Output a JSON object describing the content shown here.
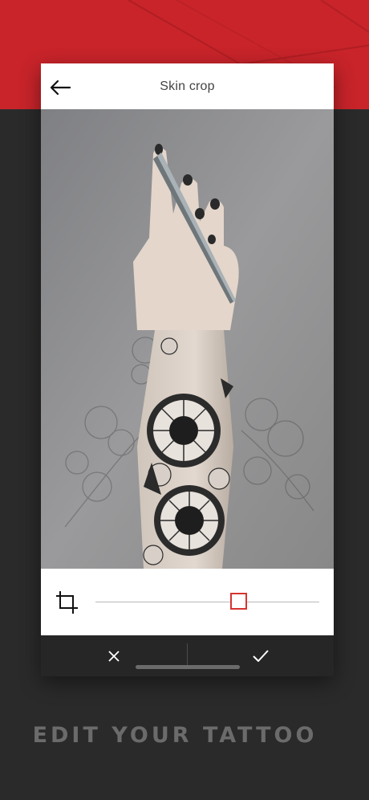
{
  "header": {
    "title": "Skin crop",
    "back_icon": "arrow-left-icon"
  },
  "controls": {
    "crop_icon": "crop-icon",
    "slider_value_fraction": 0.64
  },
  "actions": {
    "cancel_icon": "close-icon",
    "confirm_icon": "checkmark-icon"
  },
  "caption": "EDIT YOUR TATTOO",
  "colors": {
    "brand_red": "#c8242a",
    "dark_bg": "#2a2a2a",
    "thumb_accent": "#d6352f"
  }
}
